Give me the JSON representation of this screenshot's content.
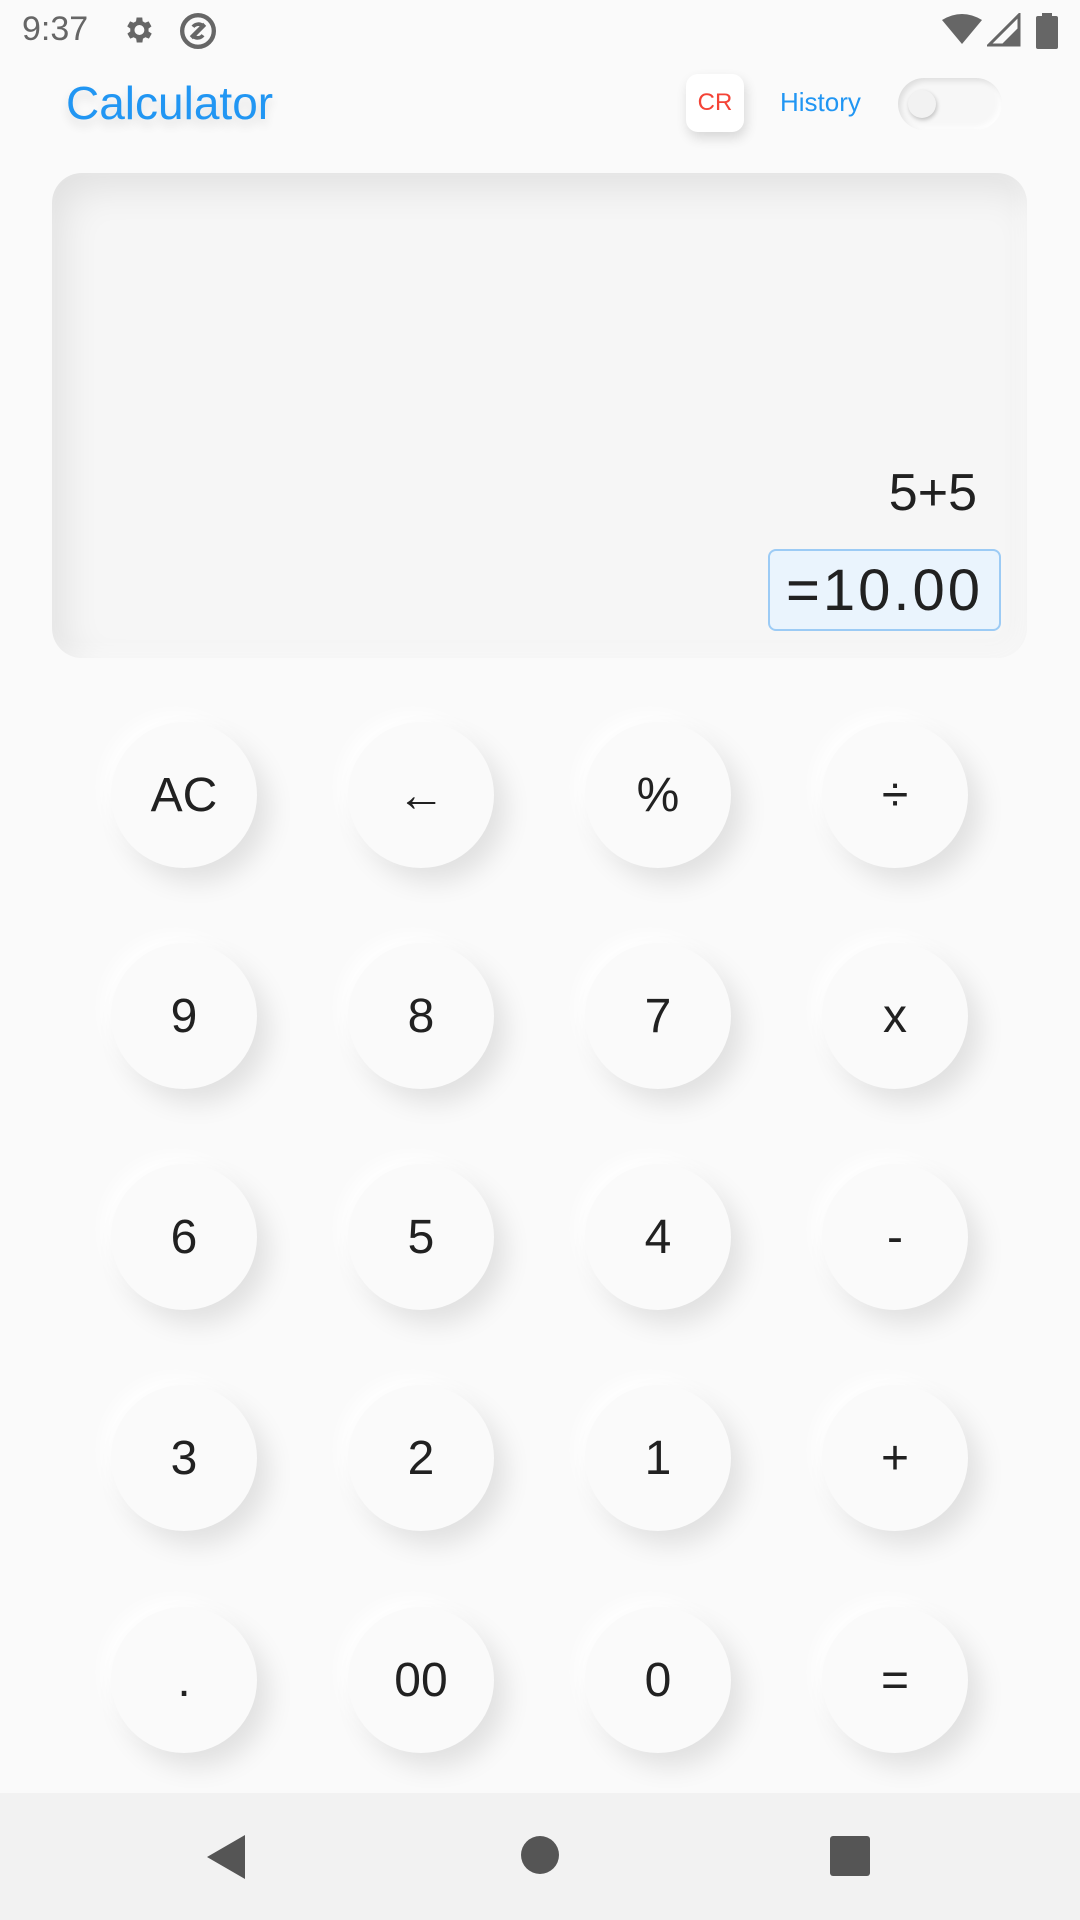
{
  "status_bar": {
    "time": "9:37",
    "icons": [
      "gear-icon",
      "no-sync-icon",
      "wifi-icon",
      "signal-icon",
      "battery-icon"
    ]
  },
  "app_bar": {
    "title": "Calculator",
    "cr_label": "CR",
    "history_label": "History",
    "history_toggle_on": false
  },
  "display": {
    "expression": "5+5",
    "result": "=10.00"
  },
  "keypad": {
    "rows": [
      [
        "AC",
        "←",
        "%",
        "÷"
      ],
      [
        "9",
        "8",
        "7",
        "x"
      ],
      [
        "6",
        "5",
        "4",
        "-"
      ],
      [
        "3",
        "2",
        "1",
        "+"
      ],
      [
        ".",
        "00",
        "0",
        "="
      ]
    ]
  },
  "nav_bar": {
    "icons": [
      "back-icon",
      "home-icon",
      "recents-icon"
    ]
  },
  "colors": {
    "accent": "#2196f3",
    "cr": "#f44336",
    "result_bg": "#eaf4fd",
    "result_border": "#9ccbf5"
  }
}
